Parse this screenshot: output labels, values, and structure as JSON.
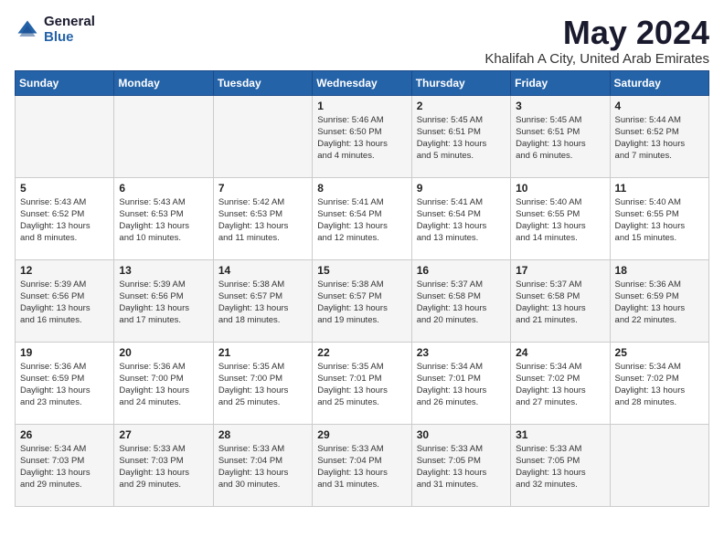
{
  "header": {
    "logo_general": "General",
    "logo_blue": "Blue",
    "month_year": "May 2024",
    "location": "Khalifah A City, United Arab Emirates"
  },
  "weekdays": [
    "Sunday",
    "Monday",
    "Tuesday",
    "Wednesday",
    "Thursday",
    "Friday",
    "Saturday"
  ],
  "weeks": [
    [
      {
        "day": "",
        "info": ""
      },
      {
        "day": "",
        "info": ""
      },
      {
        "day": "",
        "info": ""
      },
      {
        "day": "1",
        "info": "Sunrise: 5:46 AM\nSunset: 6:50 PM\nDaylight: 13 hours\nand 4 minutes."
      },
      {
        "day": "2",
        "info": "Sunrise: 5:45 AM\nSunset: 6:51 PM\nDaylight: 13 hours\nand 5 minutes."
      },
      {
        "day": "3",
        "info": "Sunrise: 5:45 AM\nSunset: 6:51 PM\nDaylight: 13 hours\nand 6 minutes."
      },
      {
        "day": "4",
        "info": "Sunrise: 5:44 AM\nSunset: 6:52 PM\nDaylight: 13 hours\nand 7 minutes."
      }
    ],
    [
      {
        "day": "5",
        "info": "Sunrise: 5:43 AM\nSunset: 6:52 PM\nDaylight: 13 hours\nand 8 minutes."
      },
      {
        "day": "6",
        "info": "Sunrise: 5:43 AM\nSunset: 6:53 PM\nDaylight: 13 hours\nand 10 minutes."
      },
      {
        "day": "7",
        "info": "Sunrise: 5:42 AM\nSunset: 6:53 PM\nDaylight: 13 hours\nand 11 minutes."
      },
      {
        "day": "8",
        "info": "Sunrise: 5:41 AM\nSunset: 6:54 PM\nDaylight: 13 hours\nand 12 minutes."
      },
      {
        "day": "9",
        "info": "Sunrise: 5:41 AM\nSunset: 6:54 PM\nDaylight: 13 hours\nand 13 minutes."
      },
      {
        "day": "10",
        "info": "Sunrise: 5:40 AM\nSunset: 6:55 PM\nDaylight: 13 hours\nand 14 minutes."
      },
      {
        "day": "11",
        "info": "Sunrise: 5:40 AM\nSunset: 6:55 PM\nDaylight: 13 hours\nand 15 minutes."
      }
    ],
    [
      {
        "day": "12",
        "info": "Sunrise: 5:39 AM\nSunset: 6:56 PM\nDaylight: 13 hours\nand 16 minutes."
      },
      {
        "day": "13",
        "info": "Sunrise: 5:39 AM\nSunset: 6:56 PM\nDaylight: 13 hours\nand 17 minutes."
      },
      {
        "day": "14",
        "info": "Sunrise: 5:38 AM\nSunset: 6:57 PM\nDaylight: 13 hours\nand 18 minutes."
      },
      {
        "day": "15",
        "info": "Sunrise: 5:38 AM\nSunset: 6:57 PM\nDaylight: 13 hours\nand 19 minutes."
      },
      {
        "day": "16",
        "info": "Sunrise: 5:37 AM\nSunset: 6:58 PM\nDaylight: 13 hours\nand 20 minutes."
      },
      {
        "day": "17",
        "info": "Sunrise: 5:37 AM\nSunset: 6:58 PM\nDaylight: 13 hours\nand 21 minutes."
      },
      {
        "day": "18",
        "info": "Sunrise: 5:36 AM\nSunset: 6:59 PM\nDaylight: 13 hours\nand 22 minutes."
      }
    ],
    [
      {
        "day": "19",
        "info": "Sunrise: 5:36 AM\nSunset: 6:59 PM\nDaylight: 13 hours\nand 23 minutes."
      },
      {
        "day": "20",
        "info": "Sunrise: 5:36 AM\nSunset: 7:00 PM\nDaylight: 13 hours\nand 24 minutes."
      },
      {
        "day": "21",
        "info": "Sunrise: 5:35 AM\nSunset: 7:00 PM\nDaylight: 13 hours\nand 25 minutes."
      },
      {
        "day": "22",
        "info": "Sunrise: 5:35 AM\nSunset: 7:01 PM\nDaylight: 13 hours\nand 25 minutes."
      },
      {
        "day": "23",
        "info": "Sunrise: 5:34 AM\nSunset: 7:01 PM\nDaylight: 13 hours\nand 26 minutes."
      },
      {
        "day": "24",
        "info": "Sunrise: 5:34 AM\nSunset: 7:02 PM\nDaylight: 13 hours\nand 27 minutes."
      },
      {
        "day": "25",
        "info": "Sunrise: 5:34 AM\nSunset: 7:02 PM\nDaylight: 13 hours\nand 28 minutes."
      }
    ],
    [
      {
        "day": "26",
        "info": "Sunrise: 5:34 AM\nSunset: 7:03 PM\nDaylight: 13 hours\nand 29 minutes."
      },
      {
        "day": "27",
        "info": "Sunrise: 5:33 AM\nSunset: 7:03 PM\nDaylight: 13 hours\nand 29 minutes."
      },
      {
        "day": "28",
        "info": "Sunrise: 5:33 AM\nSunset: 7:04 PM\nDaylight: 13 hours\nand 30 minutes."
      },
      {
        "day": "29",
        "info": "Sunrise: 5:33 AM\nSunset: 7:04 PM\nDaylight: 13 hours\nand 31 minutes."
      },
      {
        "day": "30",
        "info": "Sunrise: 5:33 AM\nSunset: 7:05 PM\nDaylight: 13 hours\nand 31 minutes."
      },
      {
        "day": "31",
        "info": "Sunrise: 5:33 AM\nSunset: 7:05 PM\nDaylight: 13 hours\nand 32 minutes."
      },
      {
        "day": "",
        "info": ""
      }
    ]
  ]
}
